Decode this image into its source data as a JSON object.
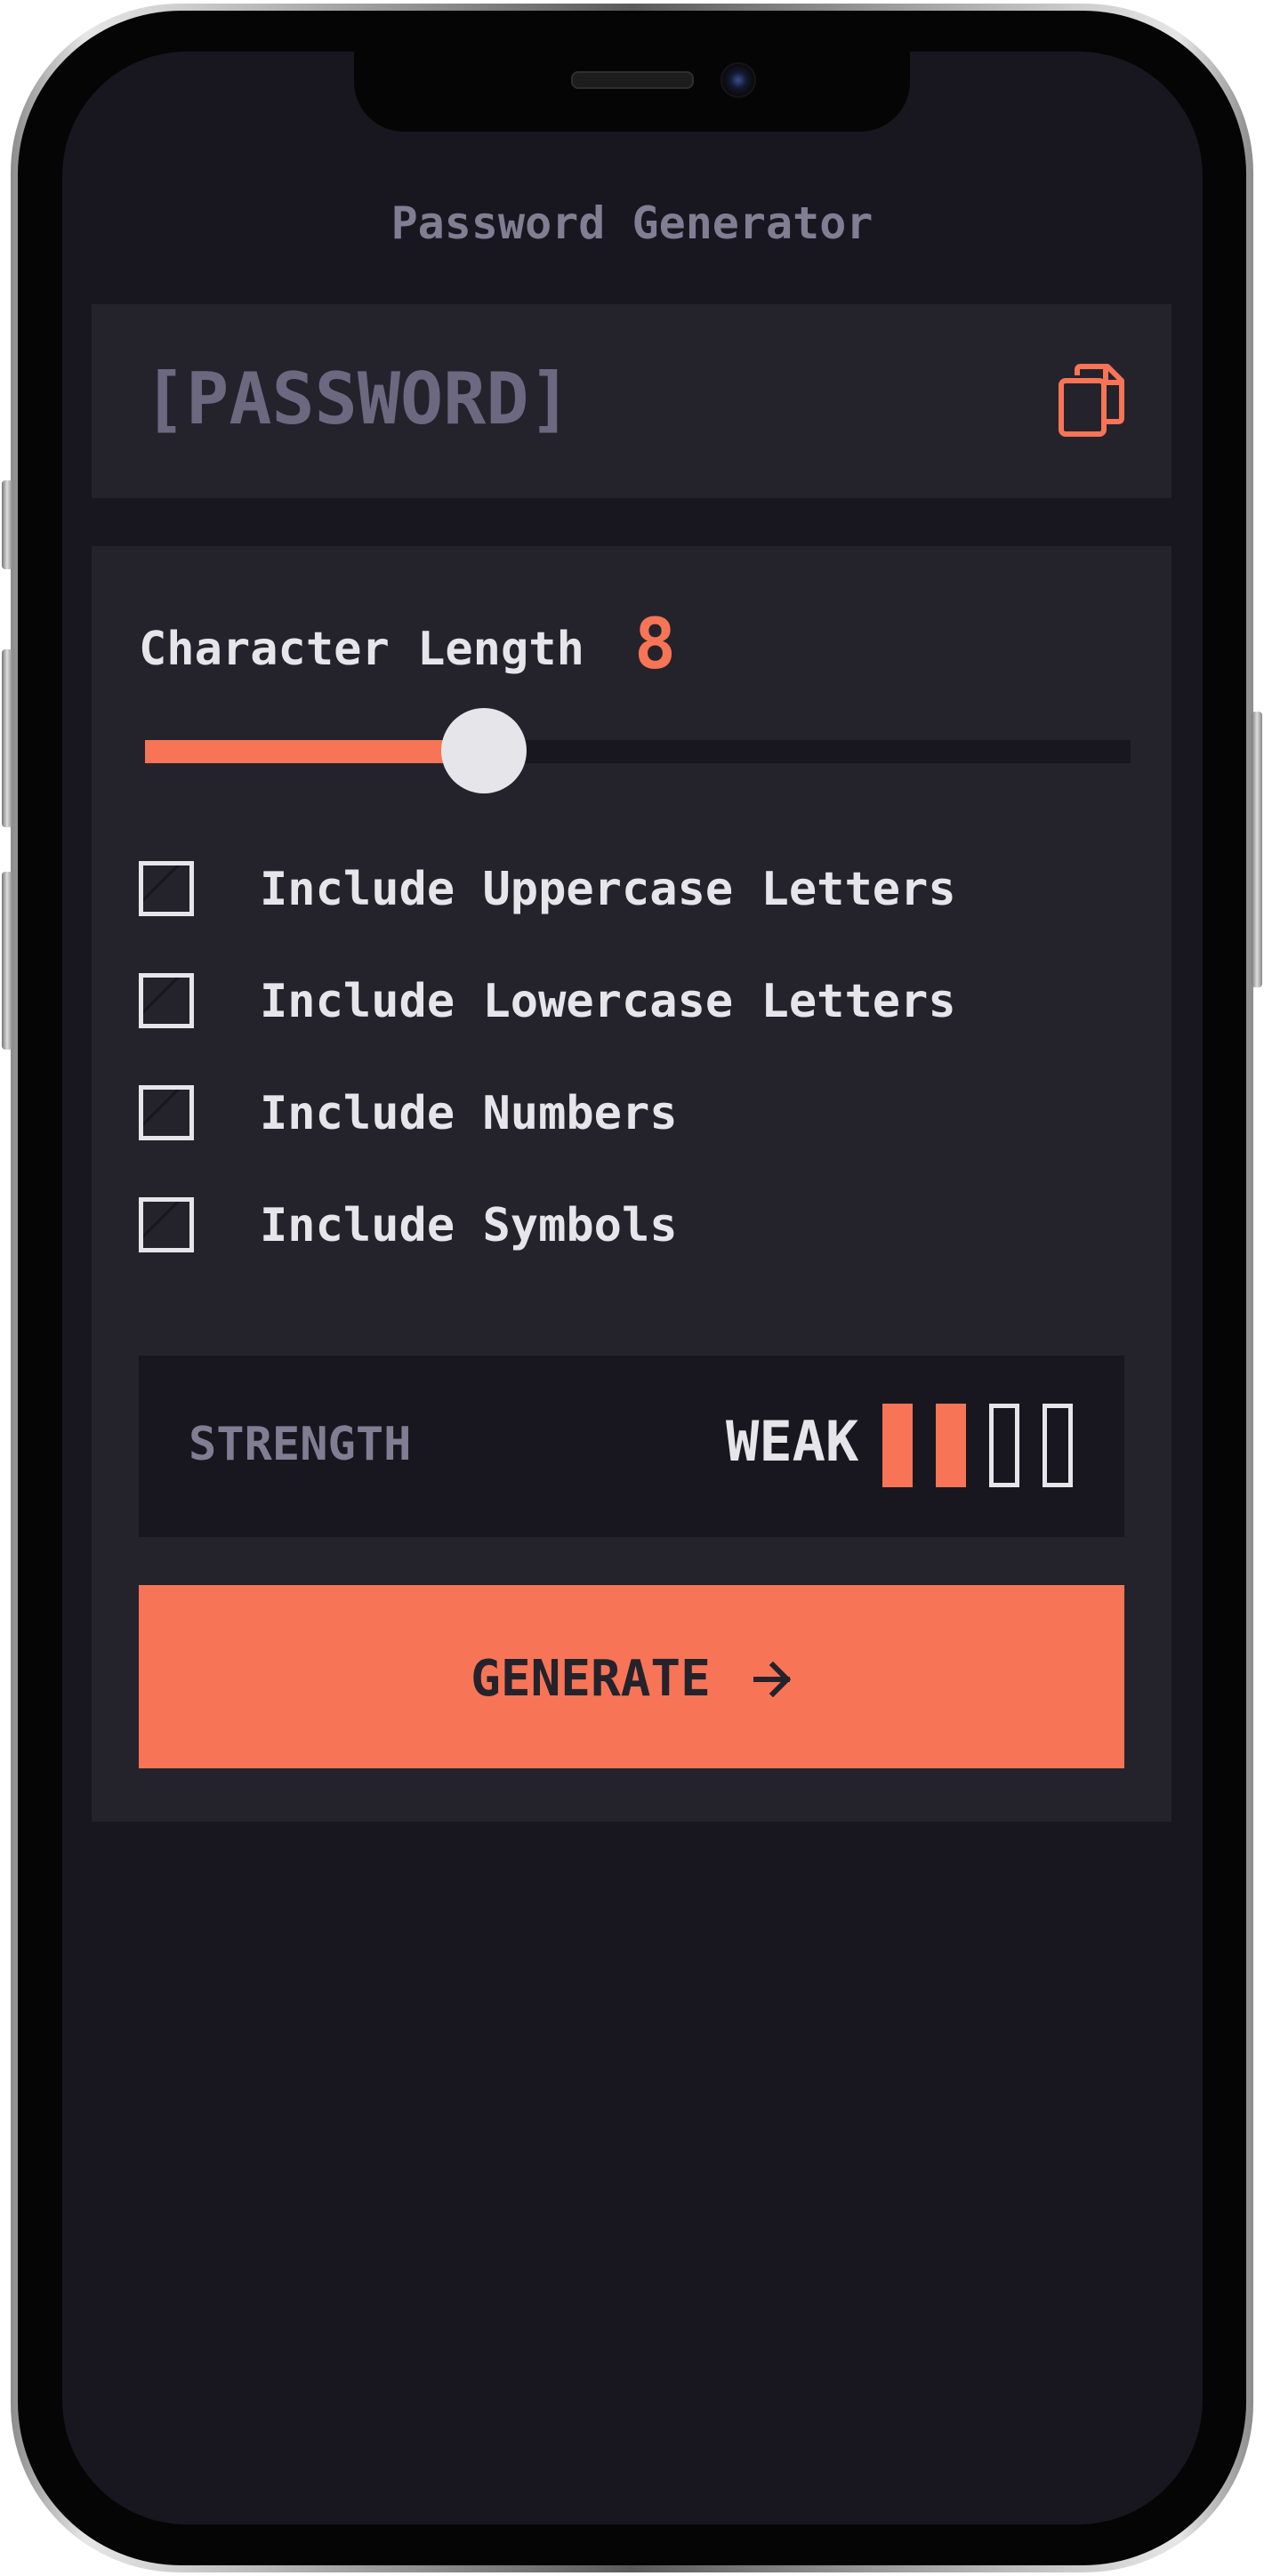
{
  "app": {
    "title": "Password Generator"
  },
  "password": {
    "placeholder": "[PASSWORD]",
    "copy_icon": "copy-icon"
  },
  "length": {
    "label": "Character Length",
    "value": "8",
    "min": 0,
    "max": 20,
    "current": 8
  },
  "options": [
    {
      "label": "Include Uppercase Letters",
      "checked": false
    },
    {
      "label": "Include Lowercase Letters",
      "checked": false
    },
    {
      "label": "Include Numbers",
      "checked": false
    },
    {
      "label": "Include Symbols",
      "checked": false
    }
  ],
  "strength": {
    "label": "STRENGTH",
    "level_text": "WEAK",
    "bars_filled": 2,
    "bars_total": 4
  },
  "generate": {
    "label": "GENERATE",
    "icon": "arrow-right-icon"
  },
  "colors": {
    "accent": "#f87456",
    "panel": "#24232c",
    "background": "#18171f",
    "text": "#e6e5ea",
    "muted": "#817d92"
  }
}
